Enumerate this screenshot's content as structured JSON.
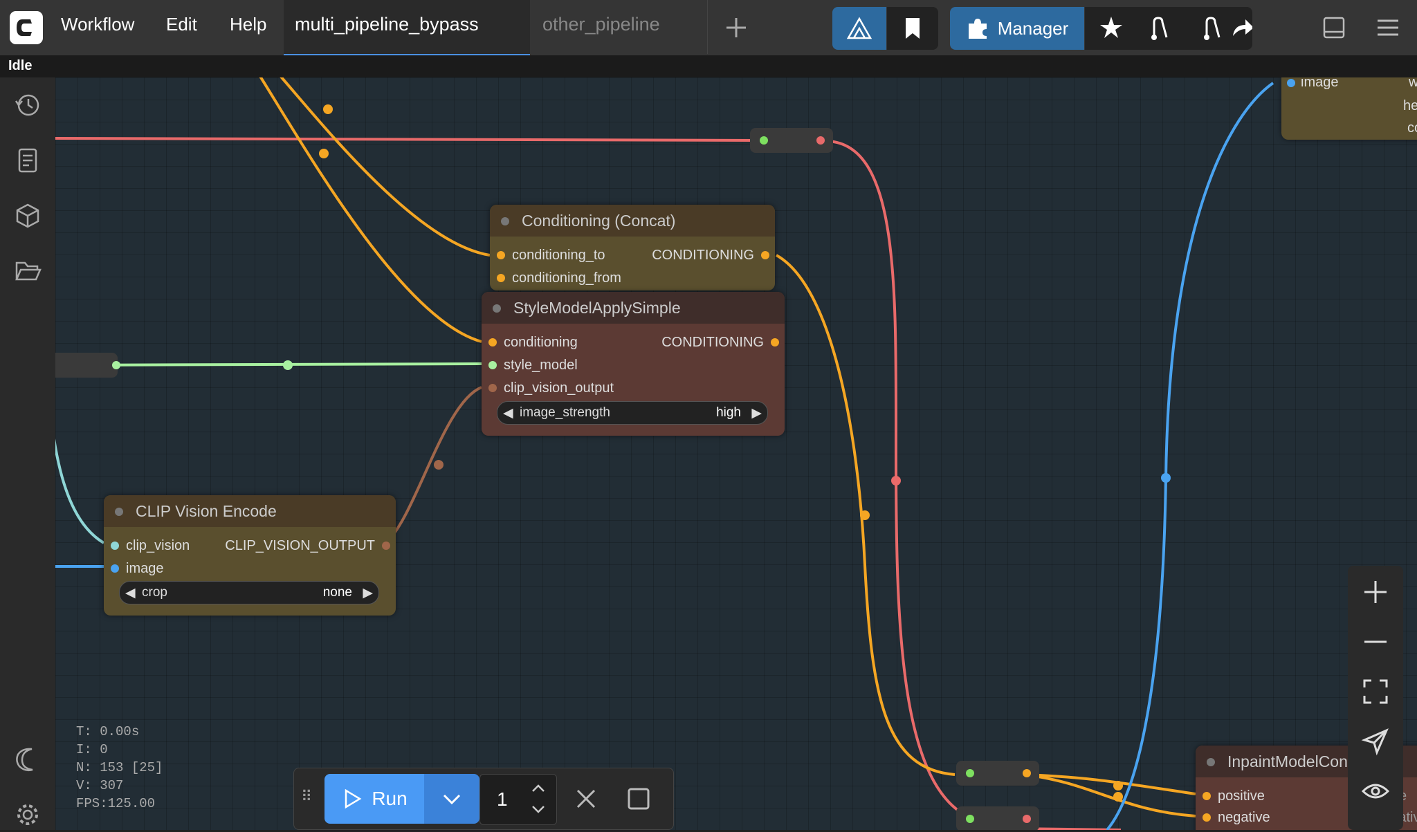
{
  "menu": {
    "workflow": "Workflow",
    "edit": "Edit",
    "help": "Help"
  },
  "tabs": [
    {
      "label": "multi_pipeline_bypass"
    },
    {
      "label": "other_pipeline"
    }
  ],
  "toolbar": {
    "manager": "Manager"
  },
  "status": "Idle",
  "nodes": {
    "concat": {
      "title": "Conditioning (Concat)",
      "in1": "conditioning_to",
      "in2": "conditioning_from",
      "out1": "CONDITIONING"
    },
    "style": {
      "title": "StyleModelApplySimple",
      "in1": "conditioning",
      "in2": "style_model",
      "in3": "clip_vision_output",
      "out1": "CONDITIONING",
      "w_name": "image_strength",
      "w_val": "high"
    },
    "clip": {
      "title": "CLIP Vision Encode",
      "in1": "clip_vision",
      "in2": "image",
      "out1": "CLIP_VISION_OUTPUT",
      "w_name": "crop",
      "w_val": "none"
    },
    "inpaint": {
      "title": "InpaintModelCon",
      "in1": "positive",
      "in2": "negative",
      "out_partial1": "e",
      "out_partial2": "negative"
    },
    "imgnode": {
      "in1": "image",
      "r1": "w",
      "r2": "he",
      "r3": "co"
    }
  },
  "stats": {
    "t": "T: 0.00s",
    "i": "I: 0",
    "n": "N: 153 [25]",
    "v": "V: 307",
    "fps": "FPS:125.00"
  },
  "run": {
    "label": "Run",
    "count": "1"
  }
}
